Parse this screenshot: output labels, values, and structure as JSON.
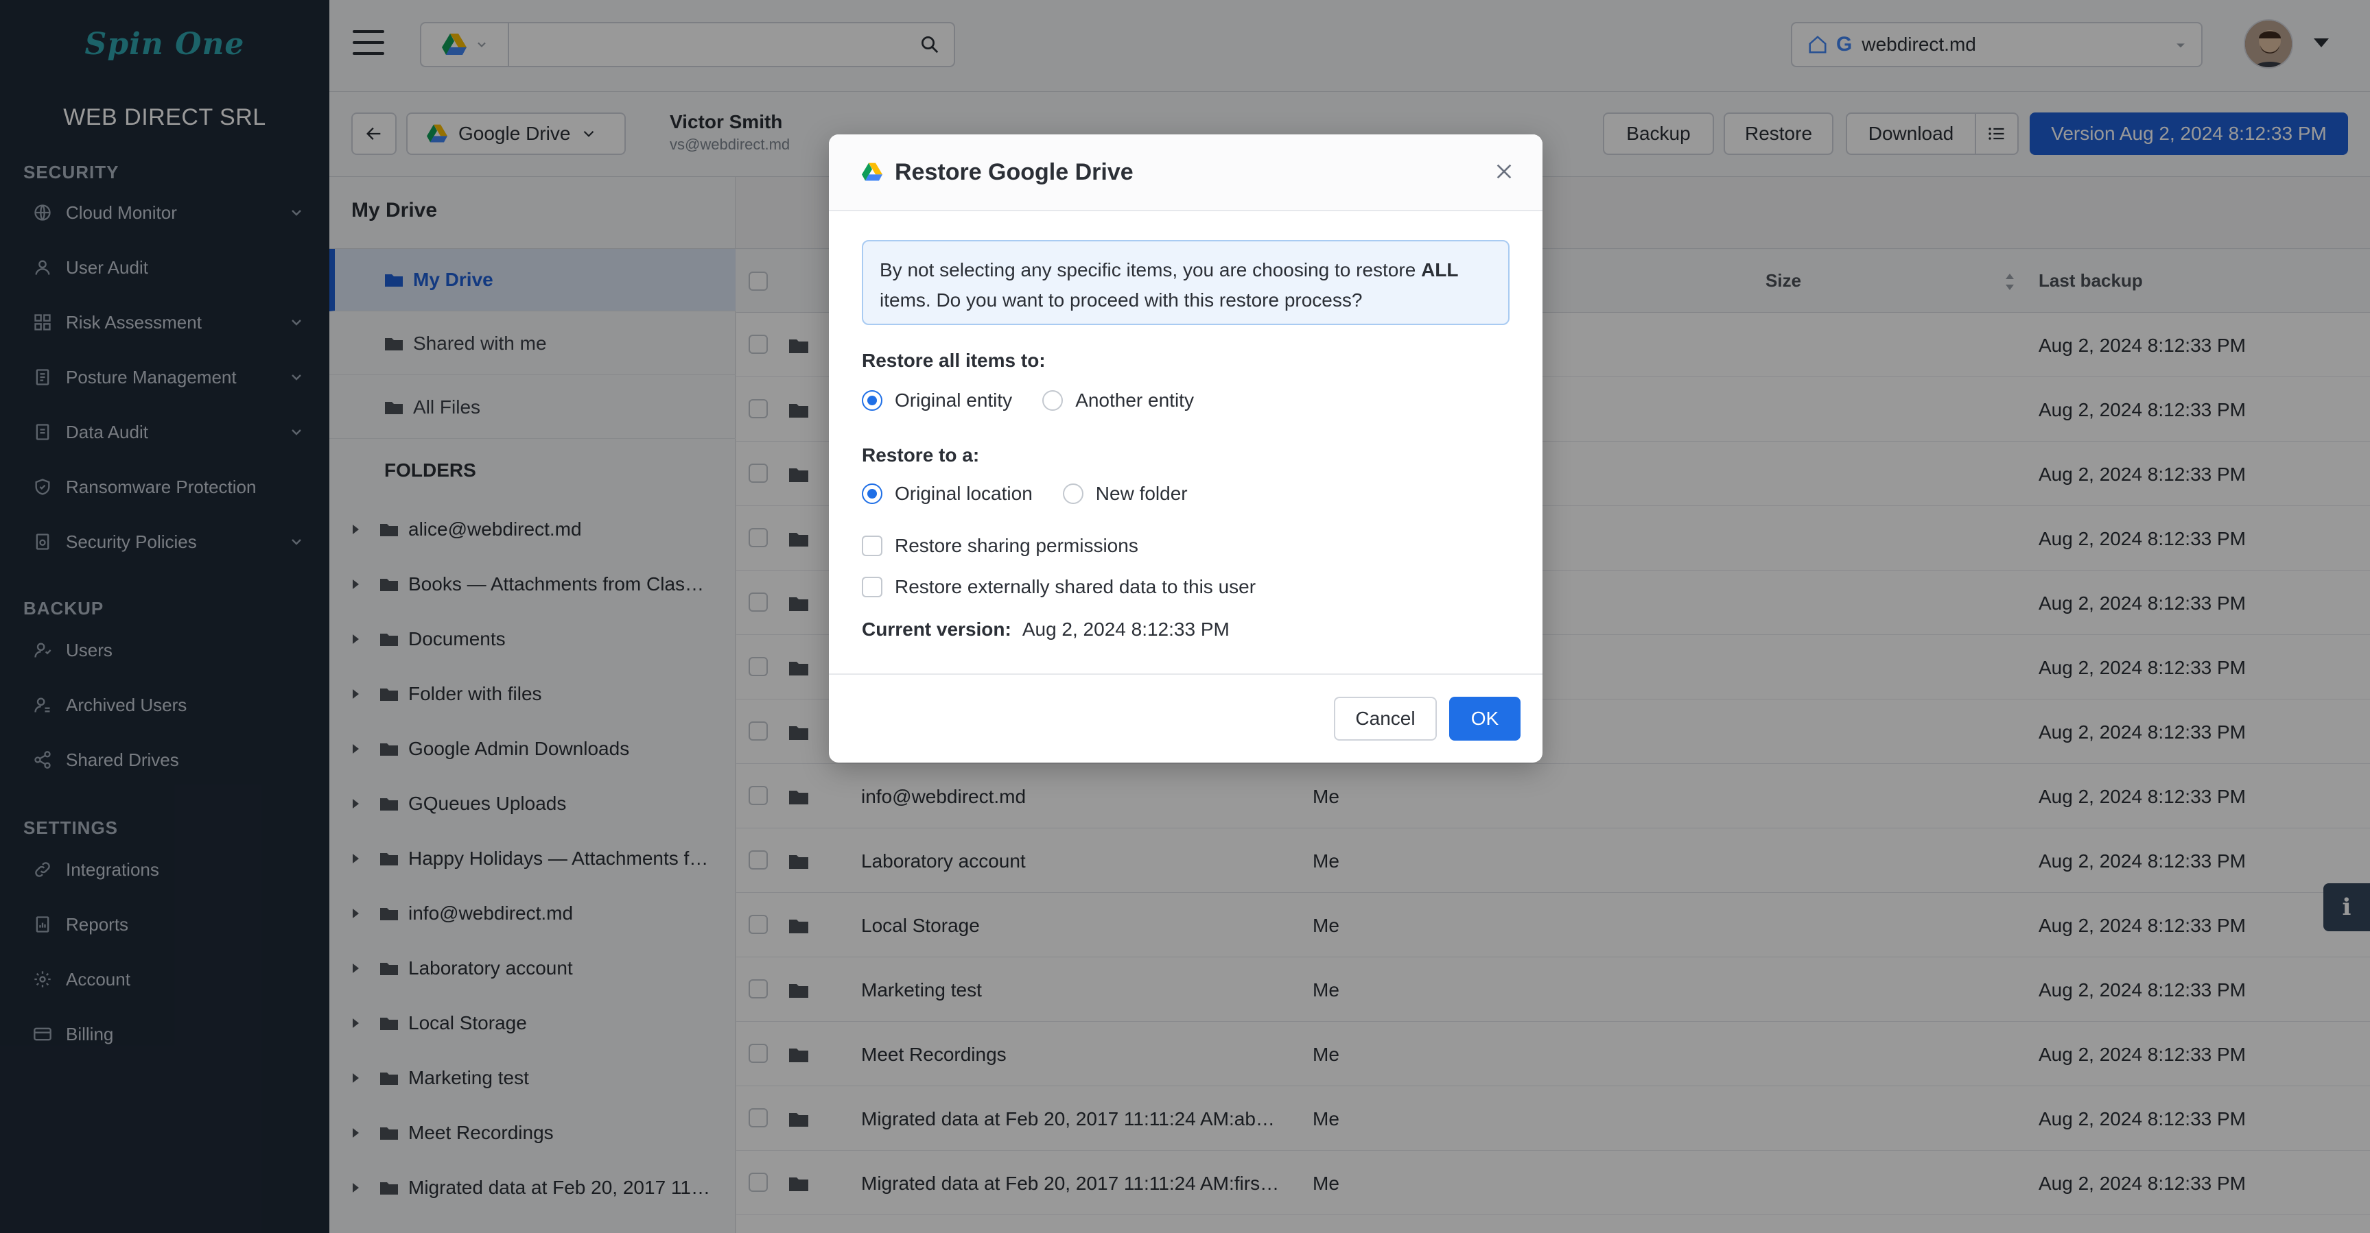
{
  "sidebar": {
    "logo_text": "Spin One",
    "org_name": "WEB DIRECT SRL",
    "sections": {
      "security": "SECURITY",
      "backup": "BACKUP",
      "settings": "SETTINGS"
    },
    "security_items": [
      {
        "label": "Cloud Monitor",
        "icon": "globe-icon",
        "expandable": true
      },
      {
        "label": "User Audit",
        "icon": "user-icon",
        "expandable": false
      },
      {
        "label": "Risk Assessment",
        "icon": "grid-icon",
        "expandable": true
      },
      {
        "label": "Posture Management",
        "icon": "clipboard-icon",
        "expandable": true
      },
      {
        "label": "Data Audit",
        "icon": "document-icon",
        "expandable": true
      },
      {
        "label": "Ransomware Protection",
        "icon": "shield-icon",
        "expandable": false
      },
      {
        "label": "Security Policies",
        "icon": "policy-icon",
        "expandable": true
      }
    ],
    "backup_items": [
      {
        "label": "Users",
        "icon": "users-icon"
      },
      {
        "label": "Archived Users",
        "icon": "archived-users-icon"
      },
      {
        "label": "Shared Drives",
        "icon": "share-icon"
      }
    ],
    "settings_items": [
      {
        "label": "Integrations",
        "icon": "link-icon"
      },
      {
        "label": "Reports",
        "icon": "report-icon"
      },
      {
        "label": "Account",
        "icon": "gear-icon"
      },
      {
        "label": "Billing",
        "icon": "card-icon"
      }
    ]
  },
  "topbar": {
    "search_value": "",
    "domain": "webdirect.md"
  },
  "toolbar": {
    "drive_label": "Google Drive",
    "user_name": "Victor Smith",
    "user_email": "vs@webdirect.md",
    "backup_label": "Backup",
    "restore_label": "Restore",
    "download_label": "Download",
    "version_label": "Version Aug 2, 2024 8:12:33 PM"
  },
  "tree": {
    "breadcrumb": "My Drive",
    "nodes": [
      "My Drive",
      "Shared with me",
      "All Files"
    ],
    "folders_title": "FOLDERS",
    "folders": [
      "alice@webdirect.md",
      "Books — Attachments from Clas…",
      "Documents",
      "Folder with files",
      "Google Admin Downloads",
      "GQueues Uploads",
      "Happy Holidays — Attachments f…",
      "info@webdirect.md",
      "Laboratory account",
      "Local Storage",
      "Marketing test",
      "Meet Recordings",
      "Migrated data at Feb 20, 2017 11…"
    ]
  },
  "table": {
    "col_size": "Size",
    "col_last_backup": "Last backup",
    "rows": [
      {
        "name": "",
        "owner": "",
        "date": "Aug 2, 2024 8:12:33 PM"
      },
      {
        "name": "",
        "owner": "",
        "date": "Aug 2, 2024 8:12:33 PM"
      },
      {
        "name": "",
        "owner": "",
        "date": "Aug 2, 2024 8:12:33 PM"
      },
      {
        "name": "",
        "owner": "",
        "date": "Aug 2, 2024 8:12:33 PM"
      },
      {
        "name": "",
        "owner": "",
        "date": "Aug 2, 2024 8:12:33 PM"
      },
      {
        "name": "",
        "owner": "",
        "date": "Aug 2, 2024 8:12:33 PM"
      },
      {
        "name": "",
        "owner": "",
        "date": "Aug 2, 2024 8:12:33 PM"
      },
      {
        "name": "info@webdirect.md",
        "owner": "Me",
        "date": "Aug 2, 2024 8:12:33 PM"
      },
      {
        "name": "Laboratory account",
        "owner": "Me",
        "date": "Aug 2, 2024 8:12:33 PM"
      },
      {
        "name": "Local Storage",
        "owner": "Me",
        "date": "Aug 2, 2024 8:12:33 PM"
      },
      {
        "name": "Marketing test",
        "owner": "Me",
        "date": "Aug 2, 2024 8:12:33 PM"
      },
      {
        "name": "Meet Recordings",
        "owner": "Me",
        "date": "Aug 2, 2024 8:12:33 PM"
      },
      {
        "name": "Migrated data at Feb 20, 2017 11:11:24 AM:ab…",
        "owner": "Me",
        "date": "Aug 2, 2024 8:12:33 PM"
      },
      {
        "name": "Migrated data at Feb 20, 2017 11:11:24 AM:firs…",
        "owner": "Me",
        "date": "Aug 2, 2024 8:12:33 PM"
      }
    ]
  },
  "modal": {
    "title": "Restore Google Drive",
    "notice_pre": "By not selecting any specific items, you are choosing to restore ",
    "notice_bold": "ALL",
    "notice_post": " items. Do you want to proceed with this restore process?",
    "restore_items_label": "Restore all items to:",
    "opt_original_entity": "Original entity",
    "opt_another_entity": "Another entity",
    "restore_to_label": "Restore to a:",
    "opt_original_location": "Original location",
    "opt_new_folder": "New folder",
    "cb_sharing": "Restore sharing permissions",
    "cb_external": "Restore externally shared data to this user",
    "current_version_label": "Current version:",
    "current_version_value": "Aug 2, 2024 8:12:33 PM",
    "cancel_label": "Cancel",
    "ok_label": "OK"
  },
  "colors": {
    "sidebar_bg": "#1f2a38",
    "primary": "#1f6fe6",
    "version_btn": "#1f5fd6",
    "logo_teal": "#2fa5b0"
  }
}
